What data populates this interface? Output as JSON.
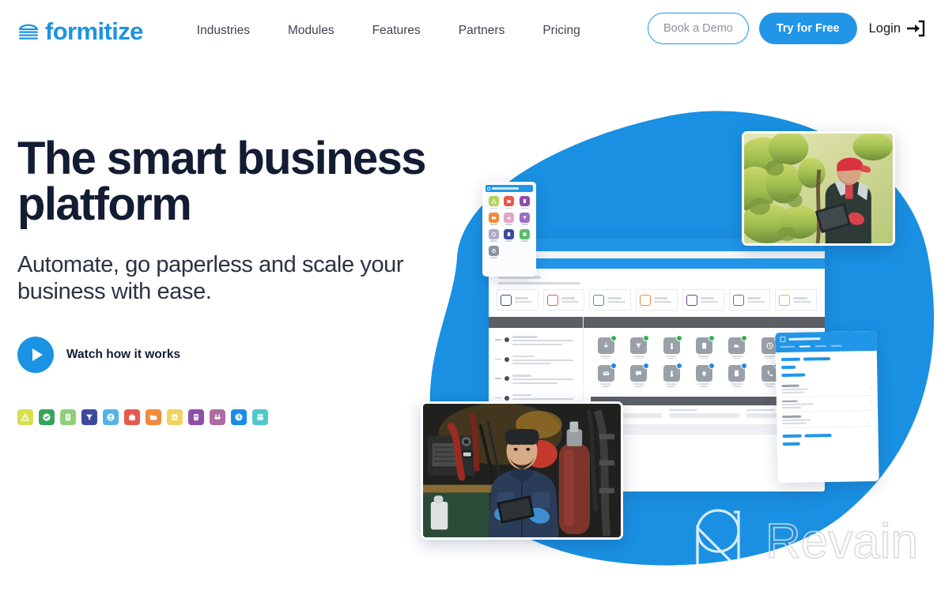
{
  "brand": {
    "name": "formitize",
    "logo_icon": "formitize-wave-logo-icon",
    "primary_color": "#1c93e3",
    "accent_blue": "#2196e8",
    "headline_color": "#121c33"
  },
  "header": {
    "nav_items": [
      {
        "label": "Industries"
      },
      {
        "label": "Modules"
      },
      {
        "label": "Features"
      },
      {
        "label": "Partners"
      },
      {
        "label": "Pricing"
      }
    ],
    "book_demo_label": "Book a Demo",
    "try_free_label": "Try for Free",
    "login_label": "Login",
    "login_icon": "sign-in-arrow-icon"
  },
  "hero": {
    "headline": "The smart business platform",
    "subheadline": "Automate, go paperless and scale your business with ease.",
    "watch_label": "Watch how it works",
    "play_icon": "play-circle-icon"
  },
  "module_icons": [
    {
      "name": "warning-triangle-icon",
      "color": "#d9e04e"
    },
    {
      "name": "check-circle-icon",
      "color": "#36a55a"
    },
    {
      "name": "document-icon",
      "color": "#8fcf7a"
    },
    {
      "name": "filter-funnel-icon",
      "color": "#3c4a9e"
    },
    {
      "name": "user-circle-icon",
      "color": "#54b4e4"
    },
    {
      "name": "briefcase-icon",
      "color": "#e8584f"
    },
    {
      "name": "folder-icon",
      "color": "#ef8b3c"
    },
    {
      "name": "chart-icon",
      "color": "#f3d25e"
    },
    {
      "name": "device-icon",
      "color": "#8e4fa8"
    },
    {
      "name": "handshake-icon",
      "color": "#b06ba0"
    },
    {
      "name": "clock-icon",
      "color": "#1a8ce8"
    },
    {
      "name": "calendar-icon",
      "color": "#4ec8c8"
    }
  ],
  "illustration": {
    "blob_color": "#1a90e2",
    "phone_app_icons": [
      {
        "name": "warning-triangle-icon",
        "color": "#b6d05a"
      },
      {
        "name": "briefcase-icon",
        "color": "#e8584f"
      },
      {
        "name": "device-icon",
        "color": "#8e4fa8"
      },
      {
        "name": "folder-icon",
        "color": "#ef8b3c"
      },
      {
        "name": "handshake-icon",
        "color": "#e2a5c6"
      },
      {
        "name": "filter-funnel-icon",
        "color": "#9b6ec4"
      },
      {
        "name": "clock-icon",
        "color": "#b0a8c8"
      },
      {
        "name": "document-icon",
        "color": "#3c4a9e"
      },
      {
        "name": "check-circle-icon",
        "color": "#5bbd6a"
      },
      {
        "name": "gear-icon",
        "color": "#8d939e"
      }
    ],
    "dashboard_tiles": [
      {
        "name": "filter-funnel-icon",
        "color": "#3c4a9e"
      },
      {
        "name": "briefcase-icon",
        "color": "#e8584f"
      },
      {
        "name": "check-circle-icon",
        "color": "#36a55a"
      },
      {
        "name": "folder-icon",
        "color": "#ef8b3c"
      },
      {
        "name": "device-icon",
        "color": "#6b3f8e"
      },
      {
        "name": "book-icon",
        "color": "#8e4fa8"
      },
      {
        "name": "document-icon",
        "color": "#b6d05a"
      }
    ],
    "grid_row_one": [
      {
        "name": "download-icon",
        "badge": "#2fb457"
      },
      {
        "name": "filter-funnel-icon",
        "badge": "#2fb457"
      },
      {
        "name": "thermometer-icon",
        "badge": "#2fb457"
      },
      {
        "name": "document-icon",
        "badge": "#2fb457"
      },
      {
        "name": "cloud-icon",
        "badge": "#2fb457"
      },
      {
        "name": "clock-icon",
        "badge": "#2fb457"
      },
      {
        "name": "folder-icon",
        "badge": "#2fb457"
      }
    ],
    "grid_row_two": [
      {
        "name": "mail-icon",
        "badge": "#1a8ce8"
      },
      {
        "name": "chat-icon",
        "badge": "#1a8ce8"
      },
      {
        "name": "thermometer-icon",
        "badge": "#1a8ce8"
      },
      {
        "name": "bell-icon",
        "badge": "#1a8ce8"
      },
      {
        "name": "document-icon",
        "badge": "#1a8ce8"
      },
      {
        "name": "phone-icon",
        "badge": "#1a8ce8"
      }
    ],
    "photo_top_alt": "field-worker-with-tablet-in-orchard",
    "photo_bottom_alt": "technician-with-tablet-in-work-van",
    "form_card_alt": "mobile-form-list-card"
  },
  "watermark": {
    "text": "Revain",
    "icon": "revain-logo-icon"
  }
}
